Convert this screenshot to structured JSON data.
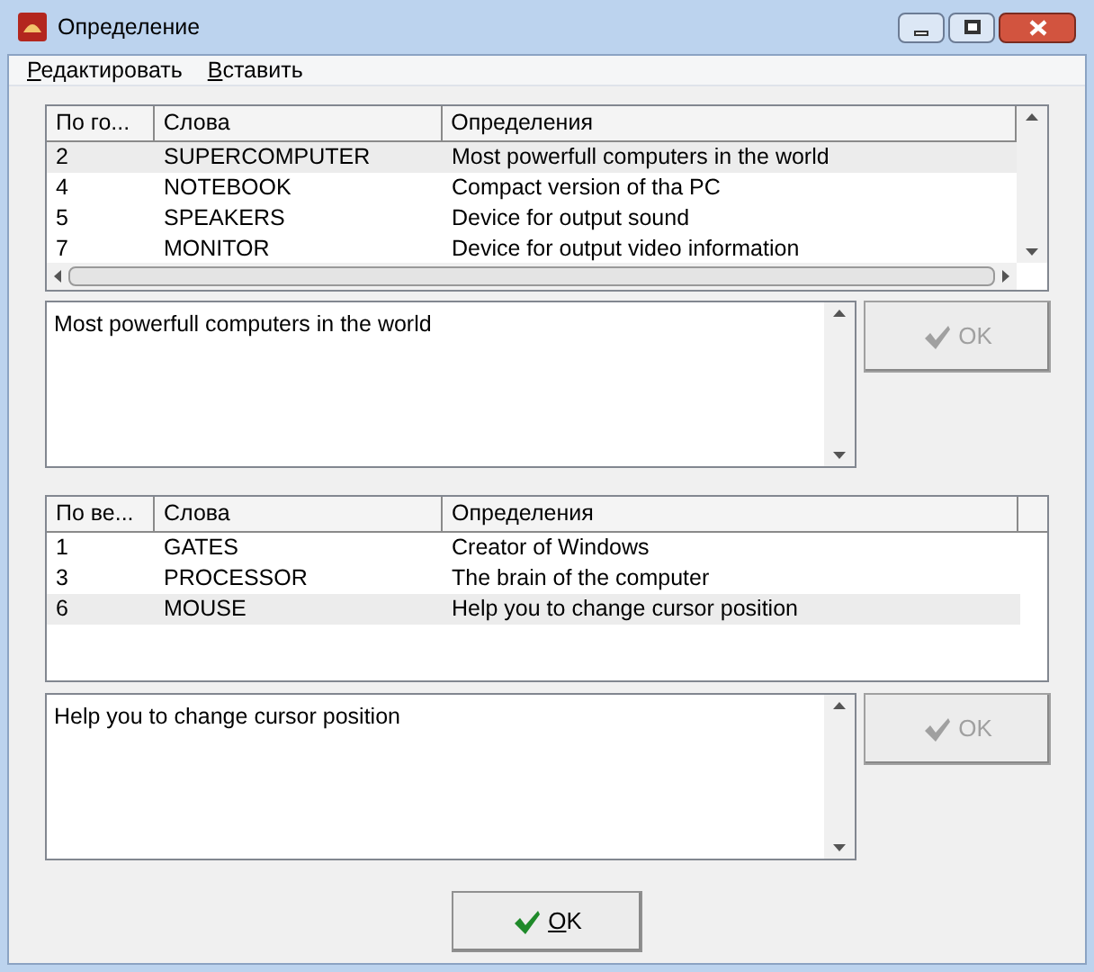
{
  "window": {
    "title": "Определение"
  },
  "menu": [
    "Редактировать",
    "Вставить"
  ],
  "top_table": {
    "columns": [
      "По го...",
      "Слова",
      "Определения"
    ],
    "rows": [
      {
        "cells": [
          "2",
          "SUPERCOMPUTER",
          "Most powerfull computers in the world"
        ],
        "selected": true
      },
      {
        "cells": [
          "4",
          "NOTEBOOK",
          "Compact version of tha PC"
        ],
        "selected": false
      },
      {
        "cells": [
          "5",
          "SPEAKERS",
          "Device for output sound"
        ],
        "selected": false
      },
      {
        "cells": [
          "7",
          "MONITOR",
          "Device for output video information"
        ],
        "selected": false
      }
    ]
  },
  "top_memo": {
    "value": "Most powerfull computers in the world"
  },
  "top_ok": {
    "label": "OK",
    "disabled": true
  },
  "bottom_table": {
    "columns": [
      "По ве...",
      "Слова",
      "Определения"
    ],
    "rows": [
      {
        "cells": [
          "1",
          "GATES",
          "Creator of Windows"
        ],
        "selected": false
      },
      {
        "cells": [
          "3",
          "PROCESSOR",
          "The brain of the computer"
        ],
        "selected": false
      },
      {
        "cells": [
          "6",
          "MOUSE",
          "Help you to change cursor position"
        ],
        "selected": true
      }
    ]
  },
  "bottom_memo": {
    "value": "Help you to change cursor position"
  },
  "bottom_ok": {
    "label": "OK",
    "disabled": true
  },
  "ok_button": {
    "label": "OK",
    "disabled": false
  }
}
